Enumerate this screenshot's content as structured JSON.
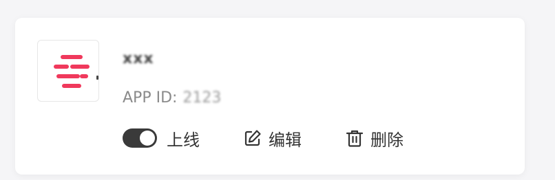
{
  "app": {
    "name": "xxx",
    "id_label": "APP ID:",
    "id_value": "2123"
  },
  "actions": {
    "toggle_label": "上线",
    "toggle_on": true,
    "edit_label": "编辑",
    "delete_label": "删除"
  },
  "icons": {
    "logo": "app-logo-icon",
    "edit": "edit-icon",
    "delete": "trash-icon"
  },
  "colors": {
    "logo_accent": "#f0395c",
    "toggle_on": "#3a3a3a"
  }
}
